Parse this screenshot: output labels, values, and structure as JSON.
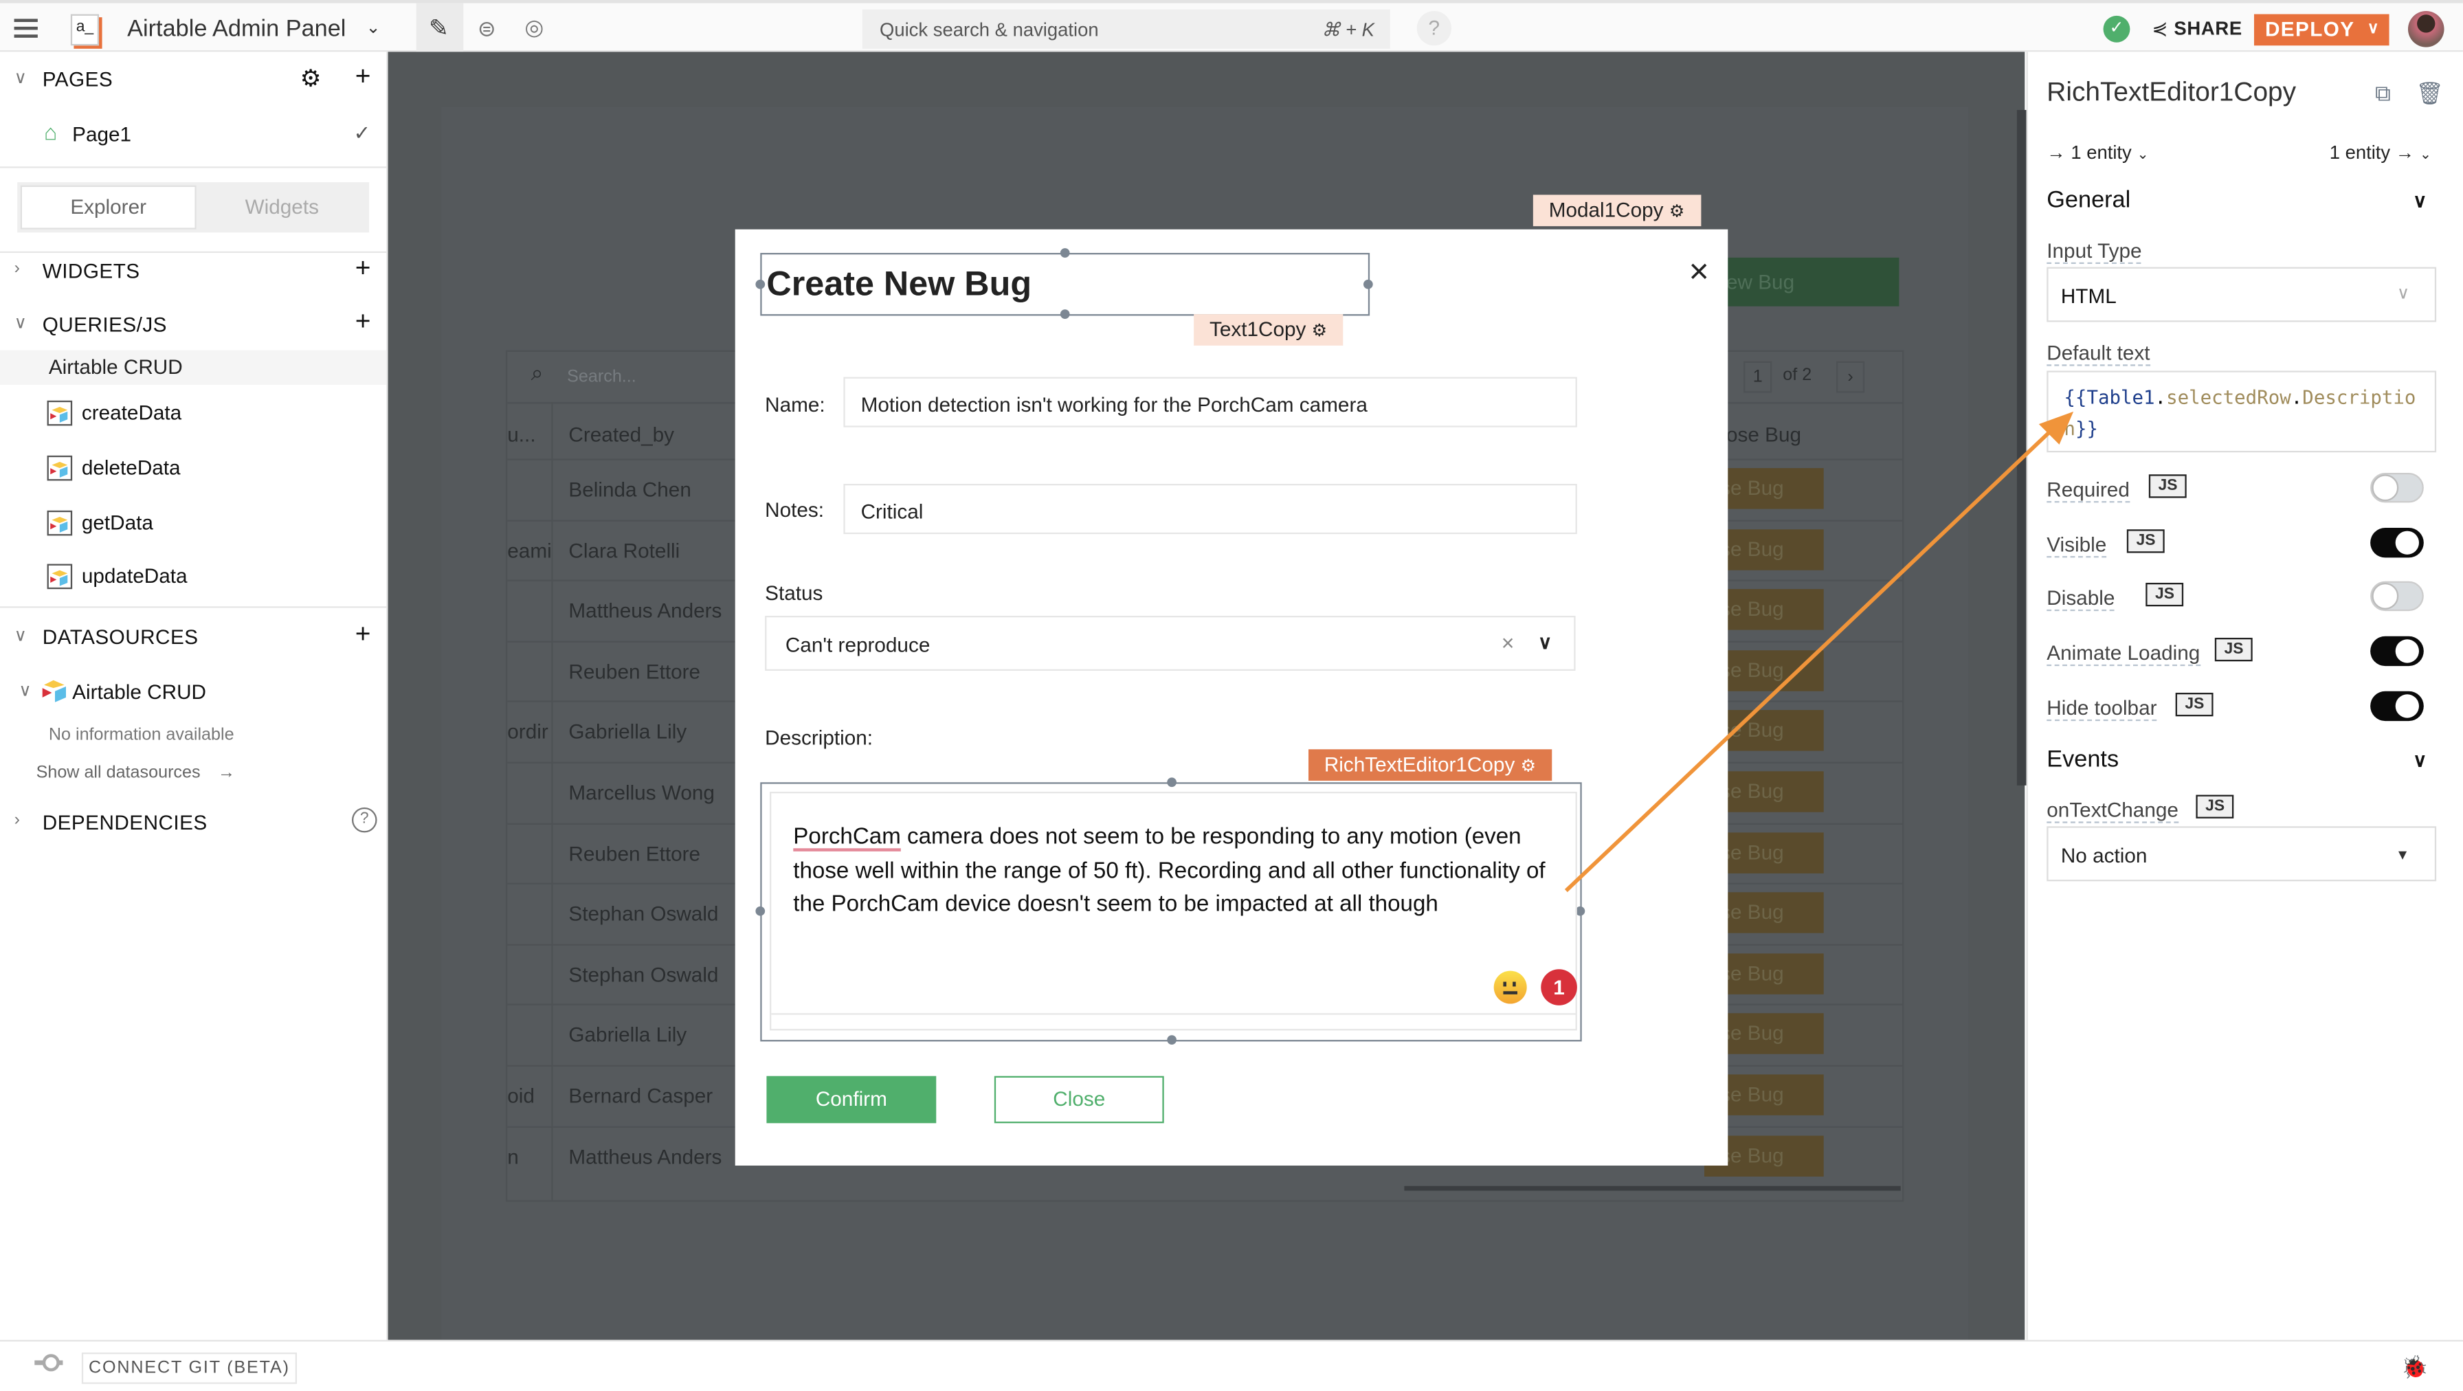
{
  "topbar": {
    "app_title": "Airtable Admin Panel",
    "logo_text": "a_",
    "search_placeholder": "Quick search & navigation",
    "search_shortcut": "⌘ + K",
    "help_label": "?",
    "share_label": "SHARE",
    "deploy_label": "DEPLOY",
    "icons": [
      "menu-icon",
      "app-logo",
      "chevron-down-icon",
      "edit-icon",
      "comment-icon",
      "preview-icon",
      "help-icon",
      "saved-check-icon",
      "share-icon",
      "avatar"
    ]
  },
  "sidebar": {
    "pages_header": "PAGES",
    "pages": [
      {
        "label": "Page1",
        "is_home": true,
        "selected": true
      }
    ],
    "tabs": [
      {
        "label": "Explorer",
        "active": true
      },
      {
        "label": "Widgets",
        "active": false
      }
    ],
    "widgets_header": "WIDGETS",
    "queries_header": "QUERIES/JS",
    "query_group": "Airtable CRUD",
    "queries": [
      {
        "label": "createData"
      },
      {
        "label": "deleteData"
      },
      {
        "label": "getData"
      },
      {
        "label": "updateData"
      }
    ],
    "datasources_header": "DATASOURCES",
    "datasource": {
      "label": "Airtable CRUD",
      "info": "No information available"
    },
    "show_all_datasources": "Show all datasources",
    "dependencies_header": "DEPENDENCIES"
  },
  "canvas": {
    "table": {
      "search_placeholder": "Search...",
      "columns": [
        "u...",
        "Created_by",
        "ose Bug"
      ],
      "page_current": "1",
      "page_total_label": "of 2",
      "rows": [
        {
          "left": "",
          "created_by": "Belinda Chen",
          "action": "lose Bug"
        },
        {
          "left": "eami",
          "created_by": "Clara Rotelli",
          "action": "lose Bug"
        },
        {
          "left": "",
          "created_by": "Mattheus Anders",
          "action": "lose Bug"
        },
        {
          "left": "",
          "created_by": "Reuben Ettore",
          "action": "lose Bug"
        },
        {
          "left": "ordir",
          "created_by": "Gabriella Lily",
          "action": "lose Bug"
        },
        {
          "left": "",
          "created_by": "Marcellus Wong",
          "action": "lose Bug"
        },
        {
          "left": "",
          "created_by": "Reuben Ettore",
          "action": "lose Bug"
        },
        {
          "left": "",
          "created_by": "Stephan Oswald",
          "action": "lose Bug"
        },
        {
          "left": "",
          "created_by": "Stephan Oswald",
          "action": "lose Bug"
        },
        {
          "left": "",
          "created_by": "Gabriella Lily",
          "action": "lose Bug"
        },
        {
          "left": "oid",
          "created_by": "Bernard Casper",
          "action": "lose Bug"
        },
        {
          "left": "n",
          "created_by": "Mattheus Anders",
          "action": "lose Bug"
        }
      ]
    },
    "new_bug_button": "ew Bug"
  },
  "modal": {
    "widget_label": "Modal1Copy",
    "title": "Create New Bug",
    "title_widget_label": "Text1Copy",
    "close_icon": "×",
    "name_label": "Name:",
    "name_value": "Motion detection isn't working for the PorchCam camera",
    "notes_label": "Notes:",
    "notes_value": "Critical",
    "status_label": "Status",
    "status_value": "Can't reproduce",
    "description_label": "Description:",
    "rte_widget_label": "RichTextEditor1Copy",
    "description_misspelled_word": "PorchCam",
    "description_rest": " camera does not seem to be responding to any motion (even those well within the range of 50 ft). Recording and all other functionality of the PorchCam device doesn't seem to be impacted at all though",
    "notification_count": "1",
    "confirm_label": "Confirm",
    "close_label": "Close"
  },
  "properties": {
    "widget_name": "RichTextEditor1Copy",
    "incoming_entities": "1 entity",
    "outgoing_entities": "1 entity",
    "general_header": "General",
    "input_type_label": "Input Type",
    "input_type_value": "HTML",
    "default_text_label": "Default text",
    "default_text_open": "{{",
    "default_text_obj": "Table1",
    "default_text_dot1": ".",
    "default_text_prop1": "selectedRow",
    "default_text_dot2": ".",
    "default_text_prop2": "Description",
    "default_text_close": "}}",
    "js_label": "JS",
    "toggles": [
      {
        "label": "Required",
        "on": false
      },
      {
        "label": "Visible",
        "on": true
      },
      {
        "label": "Disable",
        "on": false
      },
      {
        "label": "Animate Loading",
        "on": true
      },
      {
        "label": "Hide toolbar",
        "on": true
      }
    ],
    "events_header": "Events",
    "on_text_change_label": "onTextChange",
    "on_text_change_value": "No action"
  },
  "bottombar": {
    "connect_git_label": "CONNECT GIT (BETA)"
  },
  "colors": {
    "accent": "#e8713c",
    "success": "#50af6c",
    "annotation_arrow": "#f0943a",
    "badge_red": "#d8313b"
  }
}
